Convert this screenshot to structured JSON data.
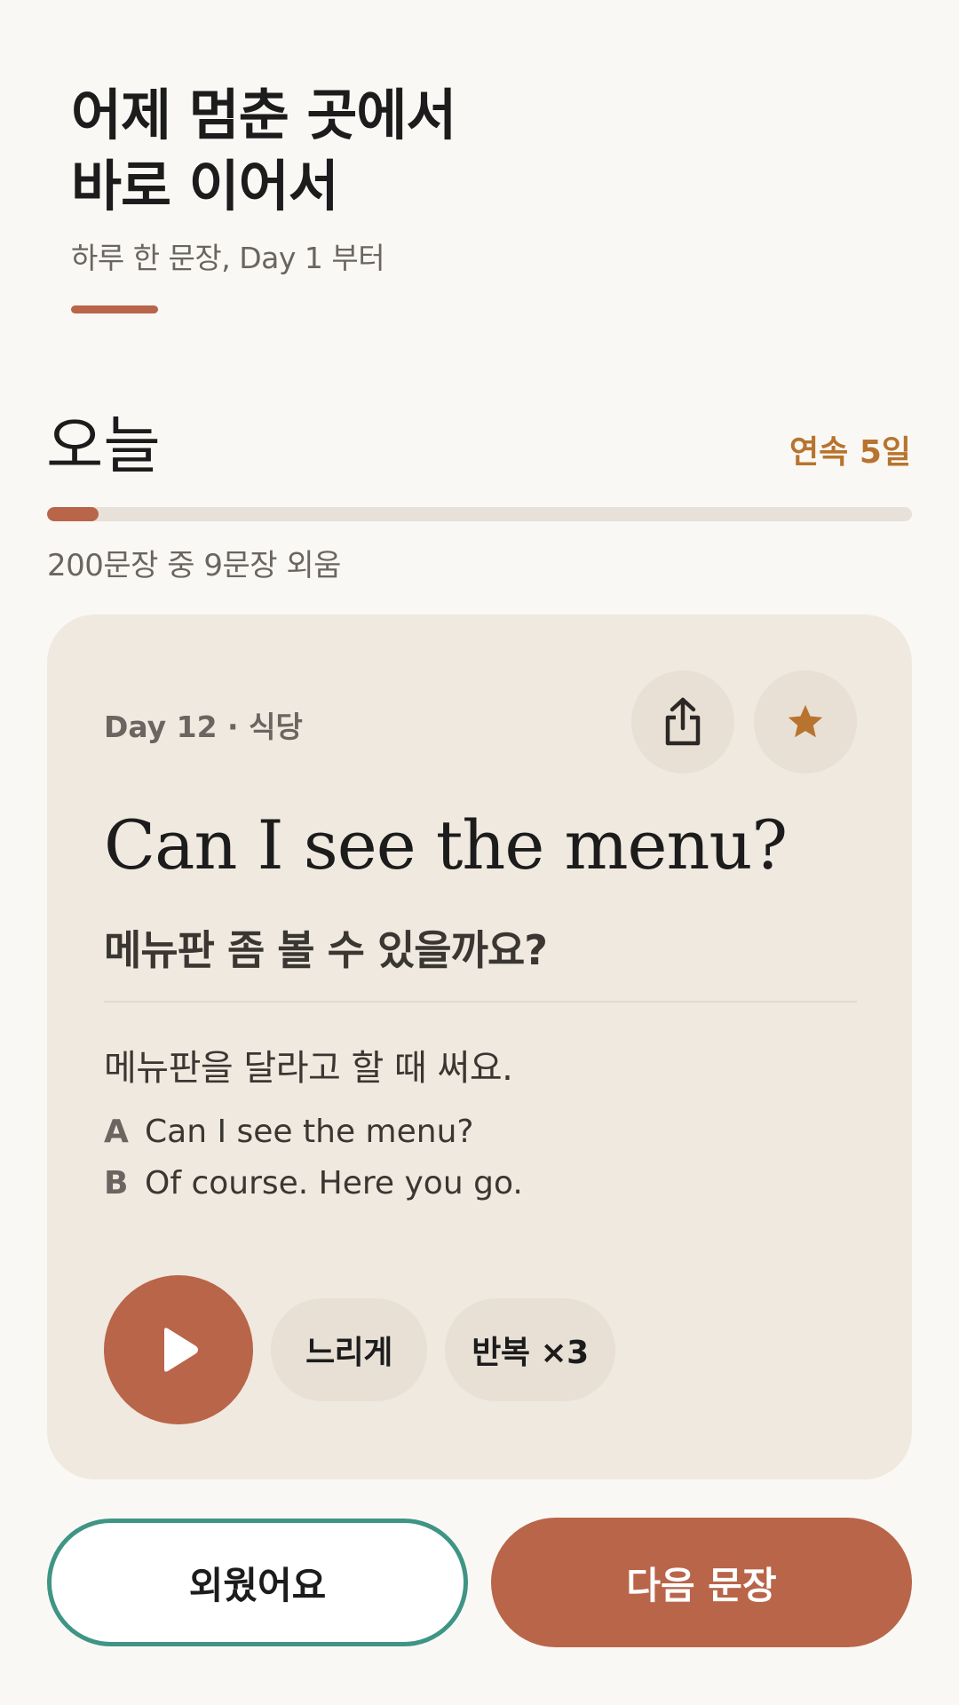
{
  "header": {
    "headline_line1": "어제 멈춘 곳에서",
    "headline_line2": "바로 이어서",
    "subtitle": "하루 한 문장, Day 1 부터"
  },
  "today": {
    "label": "오늘",
    "streak": "연속 5일",
    "progress_text": "200문장 중 9문장 외움",
    "progress_fraction": 0.06
  },
  "card": {
    "meta": "Day 12 · 식당",
    "sentence_en": "Can I see the menu?",
    "sentence_ko": "메뉴판 좀 볼 수 있을까요?",
    "usage_note": "메뉴판을 달라고 할 때 써요.",
    "dialog": [
      {
        "speaker": "A",
        "text": "Can I see the menu?"
      },
      {
        "speaker": "B",
        "text": "Of course. Here you go."
      }
    ],
    "chips": {
      "slow": "느리게",
      "repeat": "반복 ×3"
    }
  },
  "actions": {
    "memorized": "외웠어요",
    "next": "다음 문장"
  },
  "icons": {
    "share": "share-icon",
    "star": "star-icon",
    "play": "play-icon"
  },
  "colors": {
    "accent": "#b9654a",
    "streak": "#b8742f",
    "card_bg": "#f0e9df",
    "outline_button": "#3f9585"
  }
}
